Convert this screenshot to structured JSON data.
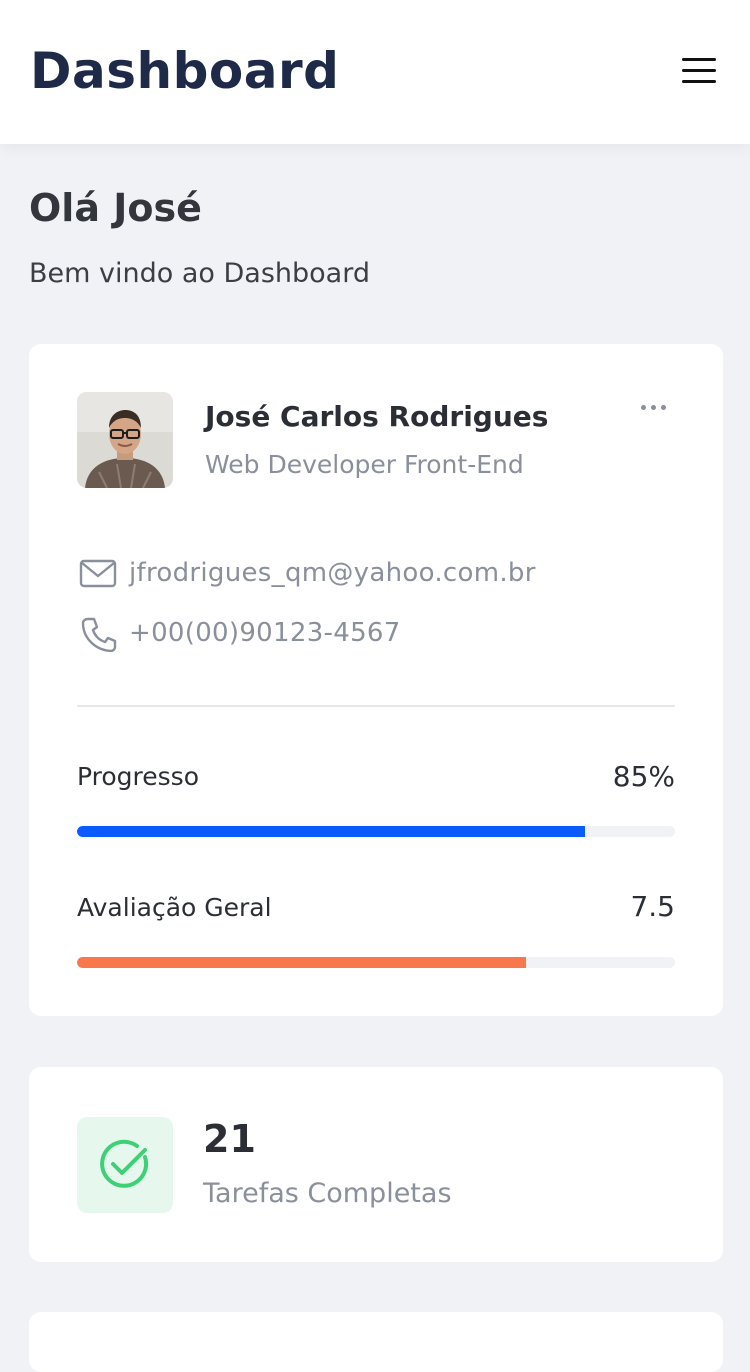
{
  "header": {
    "title": "Dashboard",
    "menu_icon": "hamburger-menu-icon"
  },
  "greeting": {
    "title": "Olá José",
    "subtitle": "Bem vindo ao Dashboard"
  },
  "profile": {
    "name": "José Carlos Rodrigues",
    "role": "Web Developer Front-End",
    "email": "jfrodrigues_qm@yahoo.com.br",
    "phone": "+00(00)90123-4567",
    "more_icon": "more-horizontal-icon"
  },
  "metrics": [
    {
      "label": "Progresso",
      "value": "85%",
      "fill": 0.85,
      "color": "#0b5cff"
    },
    {
      "label": "Avaliação Geral",
      "value": "7.5",
      "fill": 0.75,
      "color": "#f8784c"
    }
  ],
  "tasks": {
    "count": "21",
    "label": "Tarefas Completas",
    "icon": "check-circle-icon",
    "icon_color": "#3fcf75"
  }
}
